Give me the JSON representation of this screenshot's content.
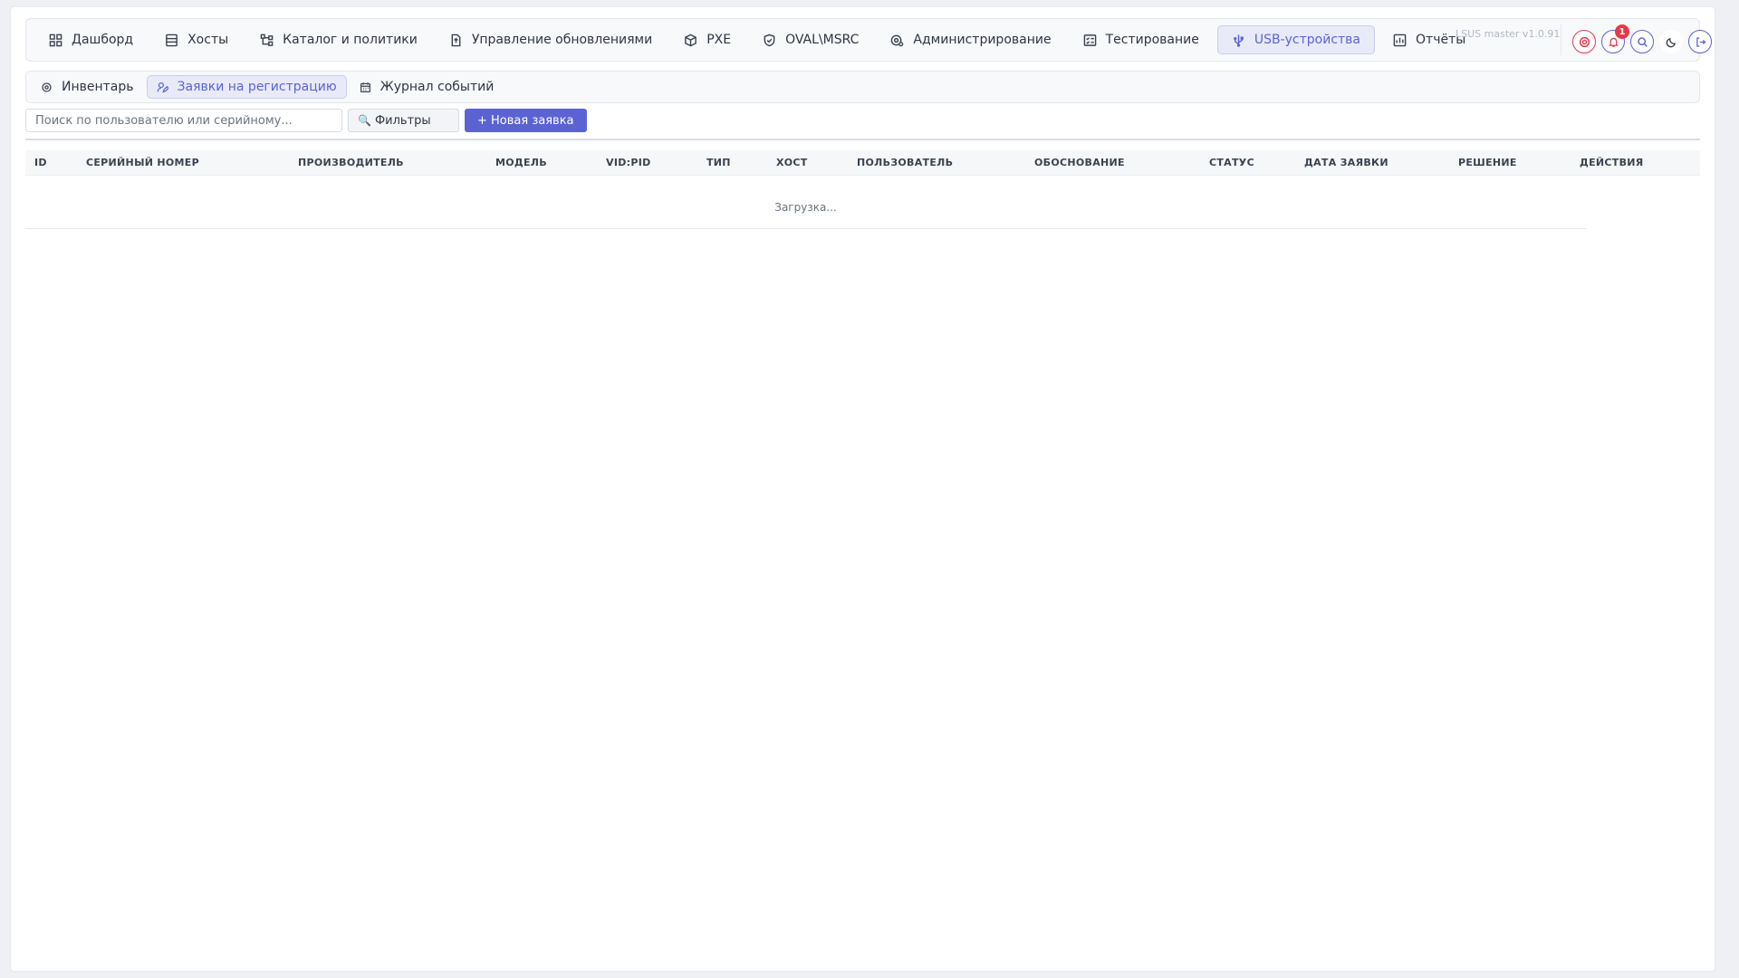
{
  "nav": {
    "items": [
      {
        "label": "Дашборд",
        "icon": "dashboard-icon"
      },
      {
        "label": "Хосты",
        "icon": "server-icon"
      },
      {
        "label": "Каталог и политики",
        "icon": "hierarchy-icon"
      },
      {
        "label": "Управление обновлениями",
        "icon": "update-file-icon"
      },
      {
        "label": "PXE",
        "icon": "box-icon"
      },
      {
        "label": "OVAL\\MSRC",
        "icon": "shield-icon"
      },
      {
        "label": "Администрирование",
        "icon": "admin-gear-icon"
      },
      {
        "label": "Тестирование",
        "icon": "checklist-icon"
      },
      {
        "label": "USB-устройства",
        "icon": "usb-icon",
        "active": true
      },
      {
        "label": "Отчёты",
        "icon": "report-icon"
      }
    ],
    "version": "LSUS master v1.0.91",
    "notification_count": "1"
  },
  "subtabs": [
    {
      "label": "Инвентарь",
      "icon": "inventory-icon"
    },
    {
      "label": "Заявки на регистрацию",
      "icon": "user-edit-icon",
      "active": true
    },
    {
      "label": "Журнал событий",
      "icon": "calendar-icon"
    }
  ],
  "toolbar": {
    "search_placeholder": "Поиск по пользователю или серийному...",
    "filters_label": "Фильтры",
    "new_request_label": "+ Новая заявка"
  },
  "table": {
    "columns": [
      "ID",
      "СЕРИЙНЫЙ НОМЕР",
      "ПРОИЗВОДИТЕЛЬ",
      "МОДЕЛЬ",
      "VID:PID",
      "ТИП",
      "ХОСТ",
      "ПОЛЬЗОВАТЕЛЬ",
      "ОБОСНОВАНИЕ",
      "СТАТУС",
      "ДАТА ЗАЯВКИ",
      "РЕШЕНИЕ",
      "ДЕЙСТВИЯ"
    ],
    "loading_text": "Загрузка..."
  },
  "colors": {
    "accent": "#5b63d3",
    "danger": "#e03e4d"
  }
}
